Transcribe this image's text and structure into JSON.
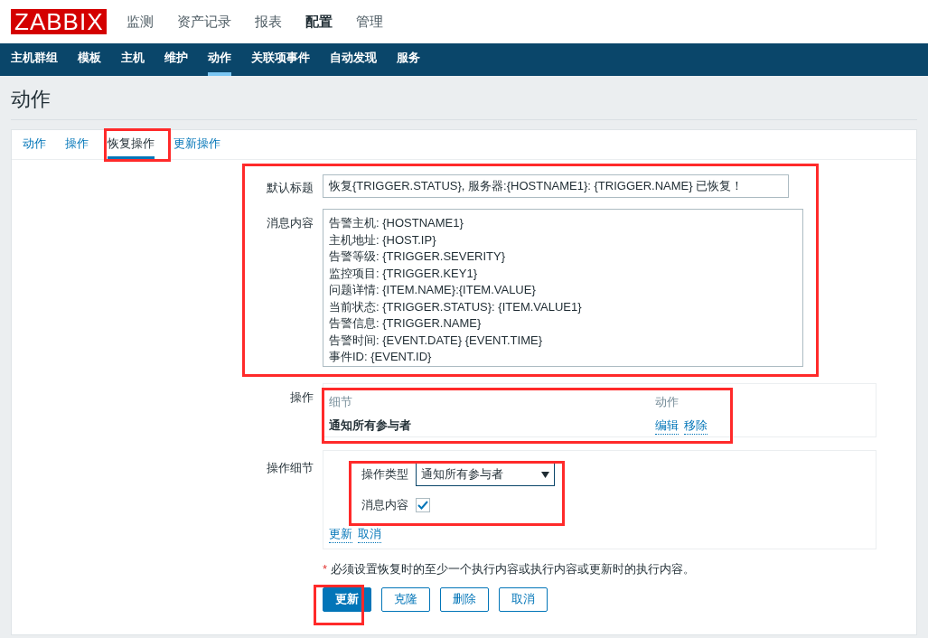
{
  "header": {
    "logo": "ZABBIX",
    "menu": [
      {
        "label": "监测",
        "selected": false
      },
      {
        "label": "资产记录",
        "selected": false
      },
      {
        "label": "报表",
        "selected": false
      },
      {
        "label": "配置",
        "selected": true
      },
      {
        "label": "管理",
        "selected": false
      }
    ]
  },
  "submenu": [
    {
      "label": "主机群组",
      "selected": false
    },
    {
      "label": "模板",
      "selected": false
    },
    {
      "label": "主机",
      "selected": false
    },
    {
      "label": "维护",
      "selected": false
    },
    {
      "label": "动作",
      "selected": true
    },
    {
      "label": "关联项事件",
      "selected": false
    },
    {
      "label": "自动发现",
      "selected": false
    },
    {
      "label": "服务",
      "selected": false
    }
  ],
  "page_title": "动作",
  "tabs": [
    {
      "label": "动作",
      "selected": false
    },
    {
      "label": "操作",
      "selected": false
    },
    {
      "label": "恢复操作",
      "selected": true
    },
    {
      "label": "更新操作",
      "selected": false
    }
  ],
  "form": {
    "subject": {
      "label": "默认标题",
      "value": "恢复{TRIGGER.STATUS}, 服务器:{HOSTNAME1}: {TRIGGER.NAME} 已恢复！"
    },
    "message": {
      "label": "消息内容",
      "value": "告警主机: {HOSTNAME1}\n主机地址: {HOST.IP}\n告警等级: {TRIGGER.SEVERITY}\n监控项目: {TRIGGER.KEY1}\n问题详情: {ITEM.NAME}:{ITEM.VALUE}\n当前状态: {TRIGGER.STATUS}:  {ITEM.VALUE1}\n告警信息: {TRIGGER.NAME}\n告警时间: {EVENT.DATE}  {EVENT.TIME}\n事件ID: {EVENT.ID}"
    },
    "operations": {
      "label": "操作",
      "columns": [
        "细节",
        "动作"
      ],
      "rows": [
        {
          "details": "通知所有参与者",
          "actions": [
            "编辑",
            "移除"
          ]
        }
      ]
    },
    "operation_details": {
      "label": "操作细节",
      "type_label": "操作类型",
      "type_value": "通知所有参与者",
      "message_label": "消息内容",
      "message_checked": true,
      "links": [
        "更新",
        "取消"
      ]
    },
    "note_mark": "*",
    "note": "必须设置恢复时的至少一个执行内容或执行内容或更新时的执行内容。",
    "buttons": [
      {
        "label": "更新",
        "kind": "primary"
      },
      {
        "label": "克隆",
        "kind": "secondary"
      },
      {
        "label": "删除",
        "kind": "secondary"
      },
      {
        "label": "取消",
        "kind": "secondary"
      }
    ]
  }
}
